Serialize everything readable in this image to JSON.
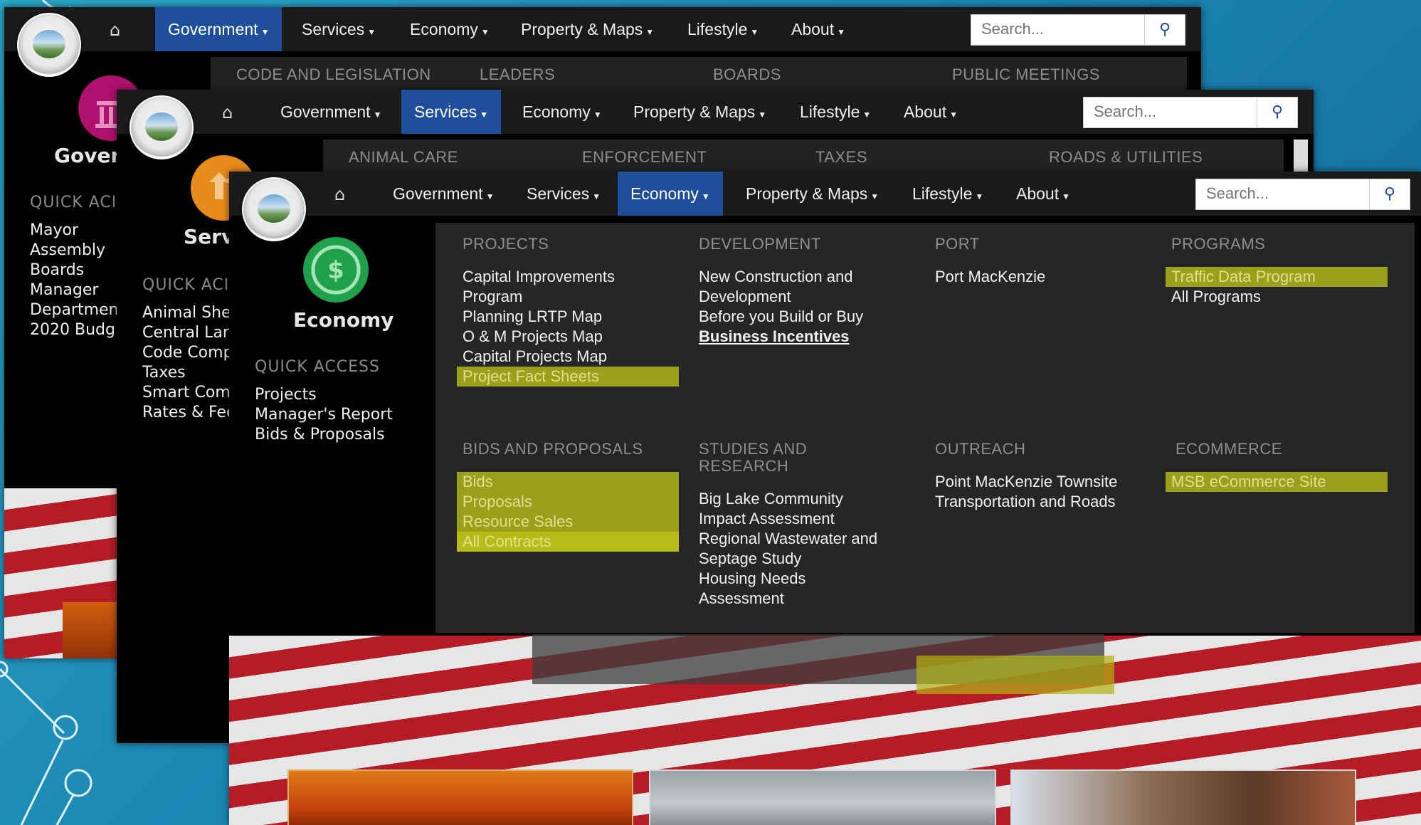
{
  "colors": {
    "accent": "#1f4e9a",
    "highlight": "#9aa01c",
    "background": "#1c86b3"
  },
  "nav": {
    "home_icon": "home-icon",
    "items": [
      "Government",
      "Services",
      "Economy",
      "Property & Maps",
      "Lifestyle",
      "About"
    ],
    "search_placeholder": "Search...",
    "search_icon": "search-icon"
  },
  "government": {
    "active": "Government",
    "subnav": [
      "CODE AND LEGISLATION",
      "LEADERS",
      "BOARDS",
      "PUBLIC MEETINGS"
    ],
    "side_icon": "government-building-icon",
    "side_title": "Goverr",
    "quick_access_head": "QUICK ACI",
    "quick_links": [
      "Mayor",
      "Assembly",
      "Boards",
      "Manager",
      "Departmen",
      "2020 Budg"
    ]
  },
  "services": {
    "active": "Services",
    "subnav": [
      "ANIMAL CARE",
      "ENFORCEMENT",
      "TAXES",
      "ROADS & UTILITIES"
    ],
    "side_icon": "services-arrows-icon",
    "side_title": "Servi",
    "quick_access_head": "QUICK ACI",
    "quick_links": [
      "Animal She",
      "Central Lar",
      "Code Comp",
      "Taxes",
      "Smart Com",
      "Rates & Fee"
    ]
  },
  "economy": {
    "active": "Economy",
    "side_icon": "dollar-icon",
    "side_title": "Economy",
    "quick_access_head": "QUICK ACCESS",
    "quick_links": [
      "Projects",
      "Manager's Report",
      "Bids & Proposals"
    ],
    "menu": {
      "projects": {
        "head": "PROJECTS",
        "links": [
          "Capital Improvements",
          "Program",
          "Planning LRTP Map",
          "O & M Projects Map",
          "Capital Projects Map",
          "Project Fact Sheets"
        ]
      },
      "development": {
        "head": "DEVELOPMENT",
        "links": [
          "New Construction and",
          "Development",
          "Before you Build or Buy",
          "Business Incentives"
        ]
      },
      "port": {
        "head": "PORT",
        "links": [
          "Port MacKenzie"
        ]
      },
      "programs": {
        "head": "PROGRAMS",
        "links": [
          "Traffic Data Program",
          "All Programs"
        ]
      },
      "bids": {
        "head": "BIDS AND PROPOSALS",
        "links": [
          "Bids",
          "Proposals",
          "Resource Sales",
          "All Contracts"
        ]
      },
      "studies": {
        "head_1": "STUDIES AND",
        "head_2": "RESEARCH",
        "links": [
          "Big Lake Community",
          "Impact Assessment",
          "Regional Wastewater and",
          "Septage Study",
          "Housing Needs",
          "Assessment"
        ]
      },
      "outreach": {
        "head": "OUTREACH",
        "links": [
          "Point MacKenzie Townsite",
          "Transportation and Roads"
        ]
      },
      "ecommerce": {
        "head": "ECOMMERCE",
        "links": [
          "MSB eCommerce Site"
        ]
      }
    }
  }
}
